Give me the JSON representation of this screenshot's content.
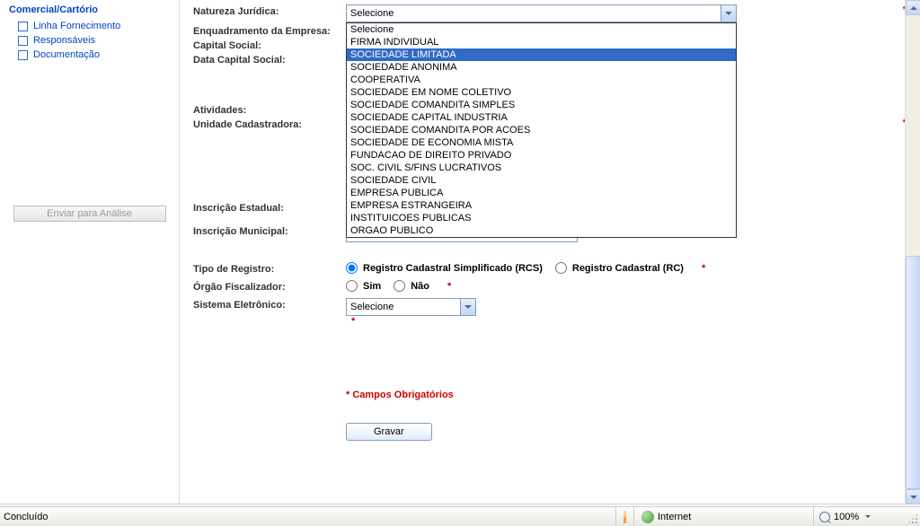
{
  "sidebar": {
    "title": "Comercial/Cartório",
    "items": [
      {
        "label": "Linha Fornecimento"
      },
      {
        "label": "Responsáveis"
      },
      {
        "label": "Documentação"
      }
    ],
    "send_button": "Enviar para Análise"
  },
  "form": {
    "natureza_label": "Natureza Jurídica:",
    "natureza_value": "Selecione",
    "natureza_options": [
      "Selecione",
      "FIRMA INDIVIDUAL",
      "SOCIEDADE LIMITADA",
      "SOCIEDADE ANONIMA",
      "COOPERATIVA",
      "SOCIEDADE EM NOME COLETIVO",
      "SOCIEDADE COMANDITA SIMPLES",
      "SOCIEDADE CAPITAL INDUSTRIA",
      "SOCIEDADE COMANDITA POR ACOES",
      "SOCIEDADE DE ECONOMIA MISTA",
      "FUNDACAO DE DIREITO PRIVADO",
      "SOC. CIVIL S/FINS LUCRATIVOS",
      "SOCIEDADE CIVIL",
      "EMPRESA PUBLICA",
      "EMPRESA ESTRANGEIRA",
      "INSTITUICOES PUBLICAS",
      "ORGAO PUBLICO"
    ],
    "natureza_selected_index": 2,
    "enquadramento_label": "Enquadramento da Empresa:",
    "capital_label": "Capital Social:",
    "data_capital_label": "Data Capital Social:",
    "atividades_label": "Atividades:",
    "unidade_label": "Unidade Cadastradora:",
    "inscricao_est_label": "Inscrição Estadual:",
    "inscricao_mun_label": "Inscrição Municipal:",
    "tipo_registro_label": "Tipo de Registro:",
    "tipo_registro_opt1": "Registro Cadastral Simplificado (RCS)",
    "tipo_registro_opt2": "Registro Cadastral (RC)",
    "orgao_label": "Órgão Fiscalizador:",
    "orgao_sim": "Sim",
    "orgao_nao": "Não",
    "sistema_label": "Sistema Eletrônico:",
    "sistema_value": "Selecione",
    "required_note": "* Campos Obrigatórios",
    "save_button": "Gravar"
  },
  "statusbar": {
    "left": "Concluído",
    "zone": "Internet",
    "zoom": "100%"
  }
}
